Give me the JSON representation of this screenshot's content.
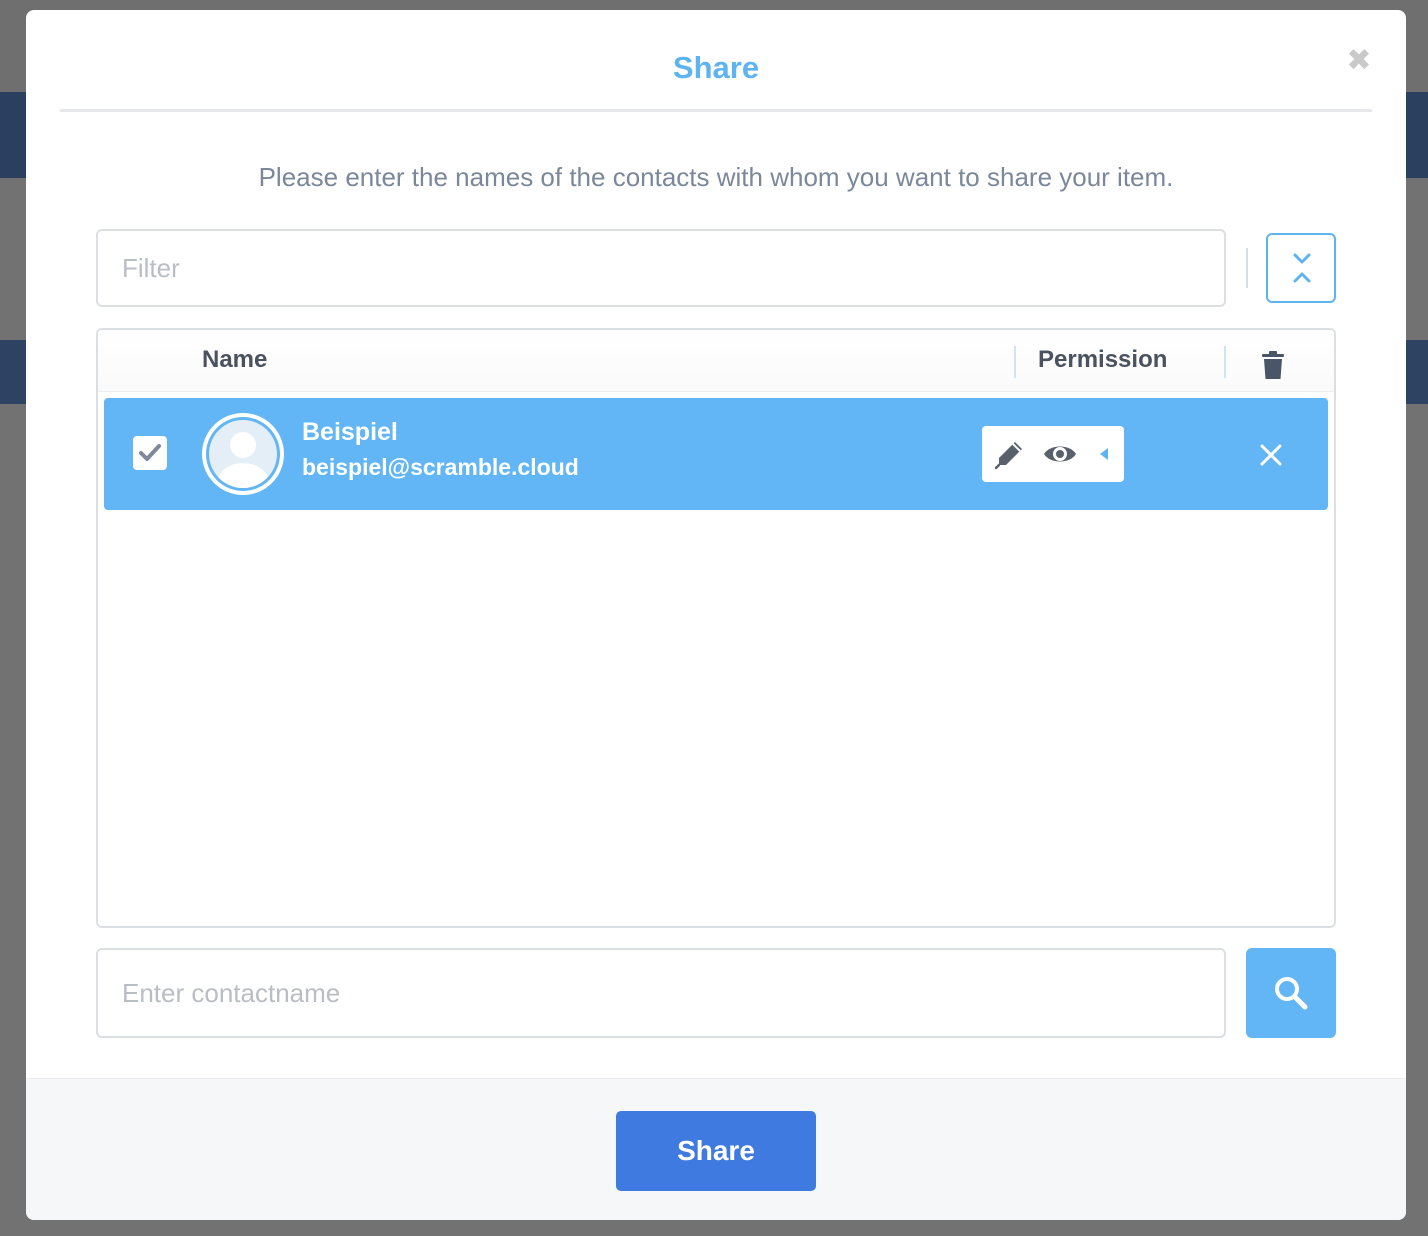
{
  "modal": {
    "title": "Share",
    "close_glyph": "✖",
    "instruction": "Please enter the names of the contacts with whom you want to share your item."
  },
  "filter": {
    "placeholder": "Filter",
    "value": ""
  },
  "table": {
    "columns": {
      "name": "Name",
      "permission": "Permission"
    },
    "rows": [
      {
        "selected": true,
        "name": "Beispiel",
        "email": "beispiel@scramble.cloud",
        "permissions": [
          "edit",
          "view"
        ]
      }
    ]
  },
  "contact_search": {
    "placeholder": "Enter contactname",
    "value": ""
  },
  "footer": {
    "share_label": "Share"
  },
  "icons": {
    "close": "close-icon",
    "collapse": "collapse-expand-icon",
    "trash": "trash-icon",
    "checkbox": "checkmark-icon",
    "avatar": "user-avatar-icon",
    "edit": "pencil-icon",
    "view": "eye-icon",
    "caret": "caret-left-icon",
    "remove": "x-icon",
    "search": "search-icon"
  },
  "colors": {
    "accent": "#5db4f0",
    "row_selected": "#62b6f5",
    "primary_button": "#3f7ae0",
    "text_muted": "#7a8899"
  }
}
